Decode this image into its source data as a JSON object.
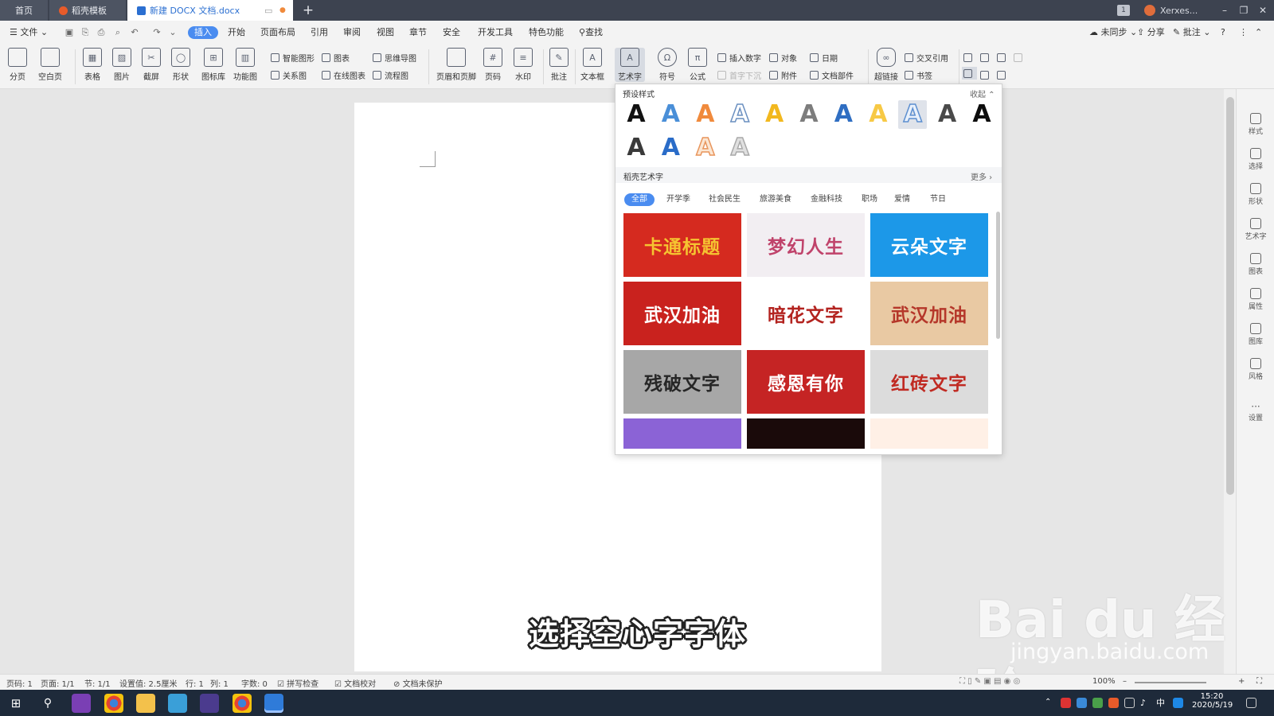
{
  "tabs": {
    "home": "首页",
    "template": "稻壳模板",
    "document": "新建 DOCX 文档.docx",
    "new_tab": "+"
  },
  "titlebar": {
    "badge": "1",
    "account": "Xerxes...",
    "minimize": "–",
    "restore": "❐",
    "close": "✕"
  },
  "menu": {
    "file": "文件",
    "items": [
      "插入",
      "开始",
      "页面布局",
      "引用",
      "审阅",
      "视图",
      "章节",
      "安全",
      "开发工具",
      "特色功能"
    ],
    "search": "查找",
    "sync": "未同步",
    "share": "分享",
    "comment": "批注",
    "help": "?"
  },
  "ribbon": {
    "page_break": "分页",
    "blank_page": "空白页",
    "table": "表格",
    "picture": "图片",
    "screenshot": "截屏",
    "shape": "形状",
    "icon_lib": "图标库",
    "func_chart": "功能图",
    "smart_graphic": "智能图形",
    "chart": "图表",
    "mind_map": "思维导图",
    "relation": "关系图",
    "online_chart": "在线图表",
    "flowchart": "流程图",
    "header_footer": "页眉和页脚",
    "page_number": "页码",
    "watermark": "水印",
    "annotate": "批注",
    "textbox": "文本框",
    "wordart": "艺术字",
    "symbol": "符号",
    "formula": "公式",
    "insert_number": "插入数字",
    "object": "对象",
    "date": "日期",
    "drop_cap": "首字下沉",
    "attachment": "附件",
    "doc_parts": "文档部件",
    "hyperlink": "超链接",
    "cross_ref": "交叉引用",
    "bookmark": "书签"
  },
  "panel": {
    "preset_title": "预设样式",
    "collapse": "收起",
    "presets": [
      {
        "glyph": "A",
        "color": "#111111"
      },
      {
        "glyph": "A",
        "color": "#4a8fd8"
      },
      {
        "glyph": "A",
        "color": "#f08a3c"
      },
      {
        "glyph": "A",
        "color": "#ffffff",
        "stroke": "#6a8fc0"
      },
      {
        "glyph": "A",
        "color": "#f2b81e"
      },
      {
        "glyph": "A",
        "color": "#7d7d7d"
      },
      {
        "glyph": "A",
        "color": "#2f6ec2"
      },
      {
        "glyph": "A",
        "color": "#f7c945"
      },
      {
        "glyph": "A",
        "color": "#e9f1fb",
        "stroke": "#5c8fd0"
      },
      {
        "glyph": "A",
        "color": "#4a4a4a"
      },
      {
        "glyph": "A",
        "color": "#0d0d0d"
      },
      {
        "glyph": "A",
        "color": "#3a3a3a"
      },
      {
        "glyph": "A",
        "color": "#2a6cc8"
      },
      {
        "glyph": "A",
        "color": "#fbe6d2",
        "stroke": "#e8955c"
      },
      {
        "glyph": "A",
        "color": "#e0e0e0",
        "stroke": "#a9a9a9"
      }
    ],
    "selected_preset": 8,
    "gallery_title": "稻壳艺术字",
    "more": "更多 ›",
    "categories": [
      "全部",
      "开学季",
      "社会民生",
      "旅游美食",
      "金融科技",
      "职场",
      "爱情",
      "节日"
    ],
    "cards": [
      {
        "text": "卡通标题",
        "bg": "#d52a1f",
        "fg": "#f5c431"
      },
      {
        "text": "梦幻人生",
        "bg": "#f2eef2",
        "fg": "#c0436b"
      },
      {
        "text": "云朵文字",
        "bg": "#1c98e8",
        "fg": "#ffffff"
      },
      {
        "text": "武汉加油",
        "bg": "#c9221e",
        "fg": "#ffffff"
      },
      {
        "text": "暗花文字",
        "bg": "#ffffff",
        "fg": "#b3231f"
      },
      {
        "text": "武汉加油",
        "bg": "#e9c9a3",
        "fg": "#b5372a"
      },
      {
        "text": "残破文字",
        "bg": "#a7a7a7",
        "fg": "#262626"
      },
      {
        "text": "感恩有你",
        "bg": "#c52424",
        "fg": "#ffffff"
      },
      {
        "text": "红砖文字",
        "bg": "#dcdcdc",
        "fg": "#c02a22"
      },
      {
        "text": "",
        "bg": "#8b63d6",
        "fg": "#ffffff"
      },
      {
        "text": "",
        "bg": "#1a0a0a",
        "fg": "#ffffff"
      },
      {
        "text": "",
        "bg": "#fff0e6",
        "fg": "#c0392b"
      }
    ]
  },
  "subtitle": "选择空心字字体",
  "watermark": {
    "logo": "Bai du 经验",
    "url": "jingyan.baidu.com"
  },
  "rail": [
    "样式",
    "选择",
    "形状",
    "艺术字",
    "图表",
    "属性",
    "图库",
    "风格",
    "设置"
  ],
  "status": {
    "page_code": "页码: 1",
    "pages": "页面: 1/1",
    "section": "节: 1/1",
    "setting": "设置值: 2.5厘米",
    "row": "行: 1",
    "col": "列: 1",
    "words": "字数: 0",
    "spell": "拼写检查",
    "proof": "文档校对",
    "protect": "文档未保护",
    "zoom": "100%"
  },
  "taskbar": {
    "ime": "中",
    "time": "15:20",
    "date": "2020/5/19"
  }
}
